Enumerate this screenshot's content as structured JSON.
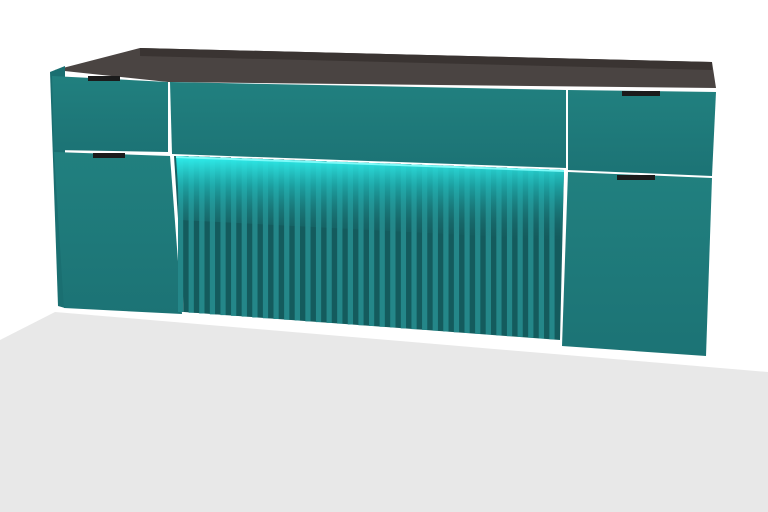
{
  "scene": {
    "subject": "vanity-cabinet",
    "colors": {
      "background": "#ffffff",
      "floor": "#e8e8e8",
      "cabinet_front": "#1f7b7d",
      "cabinet_side": "#1a6f71",
      "cabinet_shadow": "#166062",
      "interior": "#4a4442",
      "interior_dark": "#3a3432",
      "handle": "#1b1b1b",
      "led_glow": "#25e8e6",
      "slat_light": "#248789",
      "slat_dark": "#145b5d"
    },
    "slat_count": 36,
    "drawers": [
      {
        "id": "top-left-drawer"
      },
      {
        "id": "top-center-drawer"
      },
      {
        "id": "top-right-drawer"
      },
      {
        "id": "bottom-left-door"
      },
      {
        "id": "bottom-right-door"
      }
    ]
  }
}
